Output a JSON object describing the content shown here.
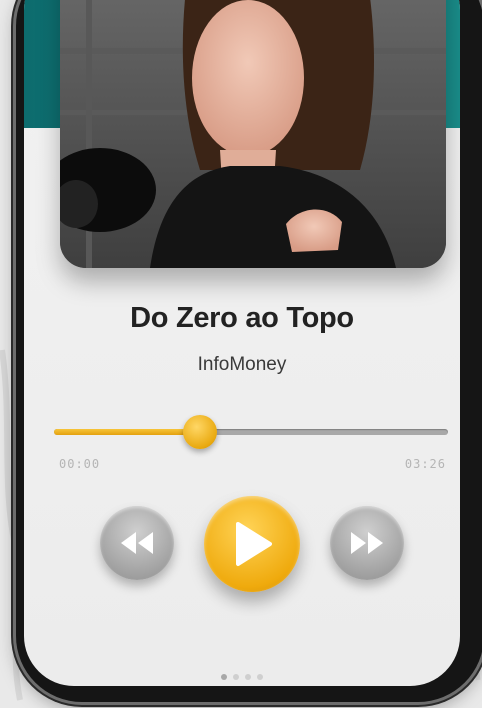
{
  "episode": {
    "title": "Do Zero ao Topo",
    "artist": "InfoMoney"
  },
  "player": {
    "progress_fraction": 0.37,
    "elapsed": "00:00",
    "duration": "03:26",
    "page_count": 4,
    "active_page": 0
  },
  "colors": {
    "accent": "#efaa0d",
    "teal": "#0d6c6e"
  },
  "icons": {
    "rewind": "rewind-icon",
    "play": "play-icon",
    "forward": "fast-forward-icon"
  }
}
